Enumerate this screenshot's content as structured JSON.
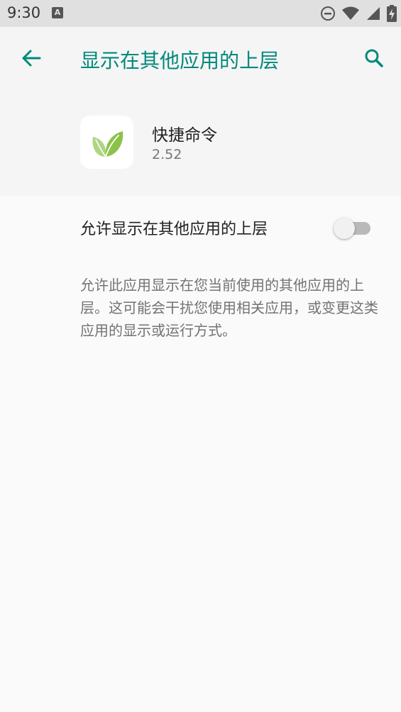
{
  "status_bar": {
    "time": "9:30",
    "notification_icon": "A",
    "icons": [
      "dnd-icon",
      "wifi-icon",
      "signal-icon",
      "battery-charging-icon"
    ]
  },
  "app_bar": {
    "title": "显示在其他应用的上层",
    "back_icon": "arrow-left-icon",
    "search_icon": "search-icon"
  },
  "app_info": {
    "name": "快捷命令",
    "version": "2.52",
    "icon": "leaf-icon"
  },
  "setting": {
    "label": "允许显示在其他应用的上层",
    "enabled": false
  },
  "description": "允许此应用显示在您当前使用的其他应用的上层。这可能会干扰您使用相关应用，或变更这类应用的显示或运行方式。",
  "colors": {
    "accent": "#00897b",
    "leaf_light": "#aed581",
    "leaf_dark": "#8bc34a"
  }
}
